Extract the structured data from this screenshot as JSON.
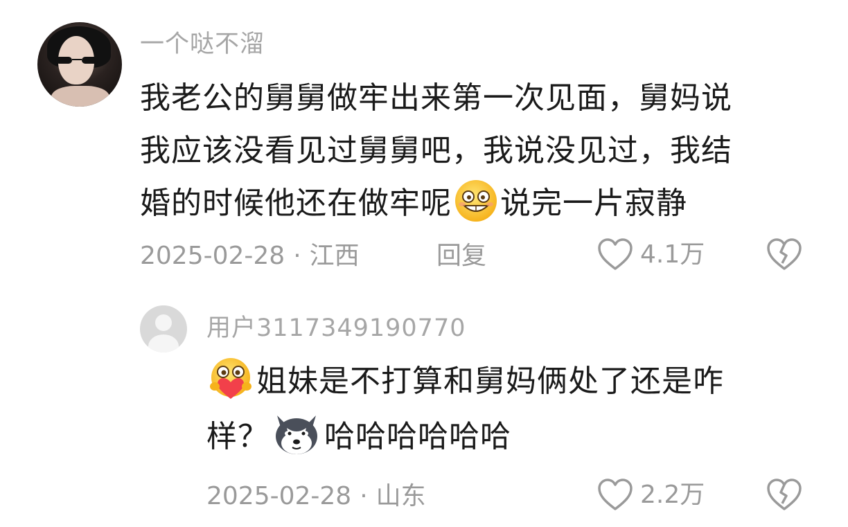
{
  "main_comment": {
    "username": "一个哒不溜",
    "lines": [
      "我老公的舅舅做牢出来第一次见面，舅妈说",
      "我应该没看见过舅舅吧，我说没见过，我结",
      "婚的时候他还在做牢呢"
    ],
    "line3_after_emoji": "说完一片寂静",
    "inline_emoji": "grinning-face-emoji",
    "date": "2025-02-28",
    "separator": "·",
    "location": "江西",
    "reply_label": "回复",
    "like_count": "4.1万",
    "like_icon": "heart-outline-icon",
    "dislike_icon": "broken-heart-icon"
  },
  "reply_comment": {
    "username": "用户3117349190770",
    "line1": "姐妹是不打算和舅妈俩处了还是咋",
    "line1_emoji": "hug-heart-emoji",
    "line2_before": "样？",
    "line2_emoji": "husky-dog-emoji",
    "line2_after": "哈哈哈哈哈哈",
    "date": "2025-02-28",
    "separator": "·",
    "location": "山东",
    "like_count": "2.2万",
    "like_icon": "heart-outline-icon",
    "dislike_icon": "broken-heart-icon"
  },
  "colors": {
    "text_primary": "#1a1a1a",
    "text_secondary": "#9a9a9a",
    "username": "#a6a6a6",
    "background": "#ffffff"
  }
}
